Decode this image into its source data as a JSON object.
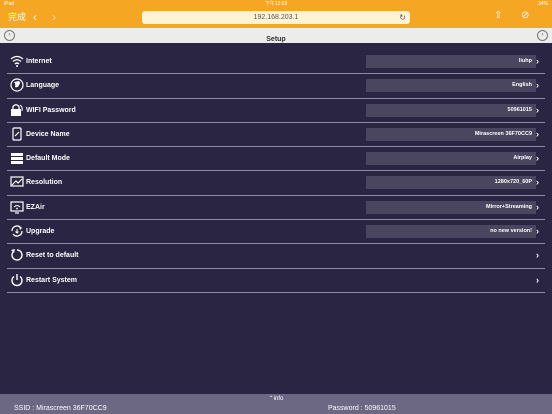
{
  "status_bar": {
    "carrier": "iPad",
    "time": "下午12:03",
    "battery": "34%"
  },
  "browser": {
    "done_label": "完成",
    "url": "192.168.203.1"
  },
  "header": {
    "title": "Setup"
  },
  "settings": [
    {
      "label": "Internet",
      "value": "liuhp",
      "icon": "wifi-icon"
    },
    {
      "label": "Language",
      "value": "English",
      "icon": "globe-icon"
    },
    {
      "label": "WIFI Password",
      "value": "50961015",
      "icon": "lock-icon"
    },
    {
      "label": "Device Name",
      "value": "Mirascreen 36F70CC9",
      "icon": "device-icon"
    },
    {
      "label": "Default Mode",
      "value": "Airplay",
      "icon": "mode-icon"
    },
    {
      "label": "Resolution",
      "value": "1280x720_60P",
      "icon": "resolution-icon"
    },
    {
      "label": "EZAir",
      "value": "Mirror+Streaming",
      "icon": "ezair-icon"
    },
    {
      "label": "Upgrade",
      "value": "no new version!",
      "icon": "upgrade-icon"
    },
    {
      "label": "Reset to default",
      "value": "",
      "icon": "reset-icon"
    },
    {
      "label": "Restart System",
      "value": "",
      "icon": "power-icon"
    }
  ],
  "footer": {
    "info_label": "info",
    "ssid": "SSID : Mirascreen 36F70CC9",
    "password": "Password : 50961015"
  }
}
